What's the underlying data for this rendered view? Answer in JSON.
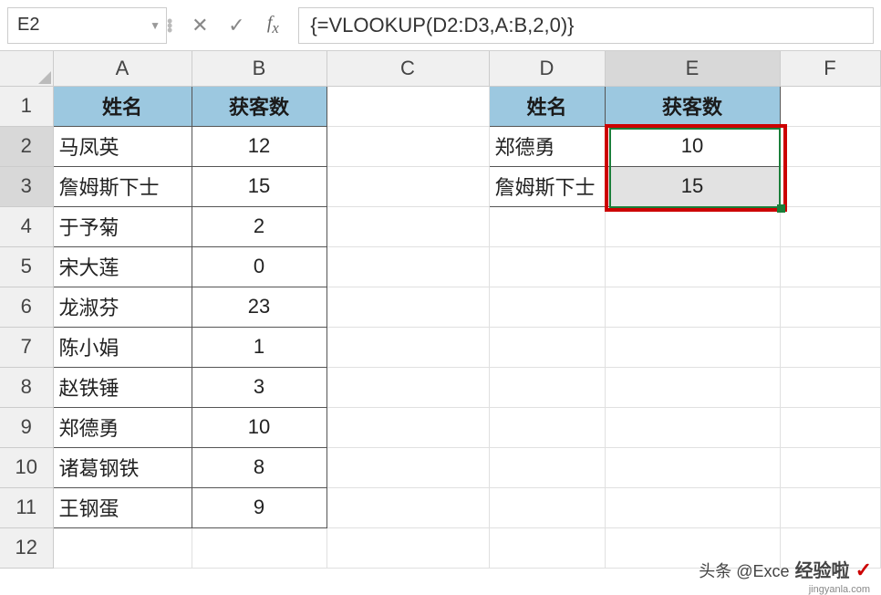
{
  "nameBox": "E2",
  "formula": "{=VLOOKUP(D2:D3,A:B,2,0)}",
  "columns": [
    "A",
    "B",
    "C",
    "D",
    "E",
    "F"
  ],
  "rows": [
    "1",
    "2",
    "3",
    "4",
    "5",
    "6",
    "7",
    "8",
    "9",
    "10",
    "11",
    "12"
  ],
  "headers": {
    "nameLabel": "姓名",
    "countLabel": "获客数"
  },
  "tableA": [
    {
      "name": "马凤英",
      "count": "12"
    },
    {
      "name": "詹姆斯下士",
      "count": "15"
    },
    {
      "name": "于予菊",
      "count": "2"
    },
    {
      "name": "宋大莲",
      "count": "0"
    },
    {
      "name": "龙淑芬",
      "count": "23"
    },
    {
      "name": "陈小娟",
      "count": "1"
    },
    {
      "name": "赵铁锤",
      "count": "3"
    },
    {
      "name": "郑德勇",
      "count": "10"
    },
    {
      "name": "诸葛钢铁",
      "count": "8"
    },
    {
      "name": "王钢蛋",
      "count": "9"
    }
  ],
  "tableD": [
    {
      "name": "郑德勇",
      "count": "10"
    },
    {
      "name": "詹姆斯下士",
      "count": "15"
    }
  ],
  "selectedColumn": "E",
  "selectedRows": [
    "2",
    "3"
  ],
  "watermark": {
    "line1": "头条 @Exce",
    "line2": "经验啦",
    "sub": "jingyanla.com"
  }
}
